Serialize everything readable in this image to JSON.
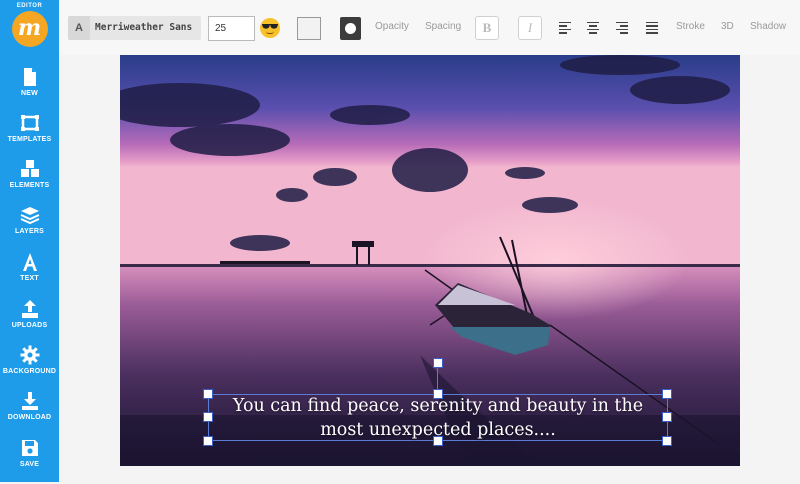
{
  "sidebar": {
    "brand_label": "EDITOR",
    "logo_letter": "m",
    "items": [
      {
        "label": "NEW",
        "icon": "file-icon"
      },
      {
        "label": "TEMPLATES",
        "icon": "templates-icon"
      },
      {
        "label": "ELEMENTS",
        "icon": "elements-icon"
      },
      {
        "label": "LAYERS",
        "icon": "layers-icon"
      },
      {
        "label": "TEXT",
        "icon": "text-icon"
      },
      {
        "label": "UPLOADS",
        "icon": "upload-icon"
      },
      {
        "label": "BACKGROUND",
        "icon": "gear-icon"
      },
      {
        "label": "DOWNLOAD",
        "icon": "download-icon"
      },
      {
        "label": "SAVE",
        "icon": "save-icon"
      }
    ]
  },
  "toolbar": {
    "font_icon_label": "A",
    "font_name": "Merriweather Sans",
    "font_size": "25",
    "emoji_icon": "sunglasses-emoji-icon",
    "text_color": "#f2f2f2",
    "background_color": "#3c3c3c",
    "opacity_label": "Opacity",
    "spacing_label": "Spacing",
    "bold_label": "B",
    "italic_label": "I",
    "stroke_label": "Stroke",
    "three_d_label": "3D",
    "shadow_label": "Shadow"
  },
  "canvas": {
    "caption_line1": "You can find peace, serenity and beauty in the",
    "caption_line2": "most unexpected places....",
    "accent_color": "#1e9be9",
    "selection_color": "#5a7bd6"
  }
}
